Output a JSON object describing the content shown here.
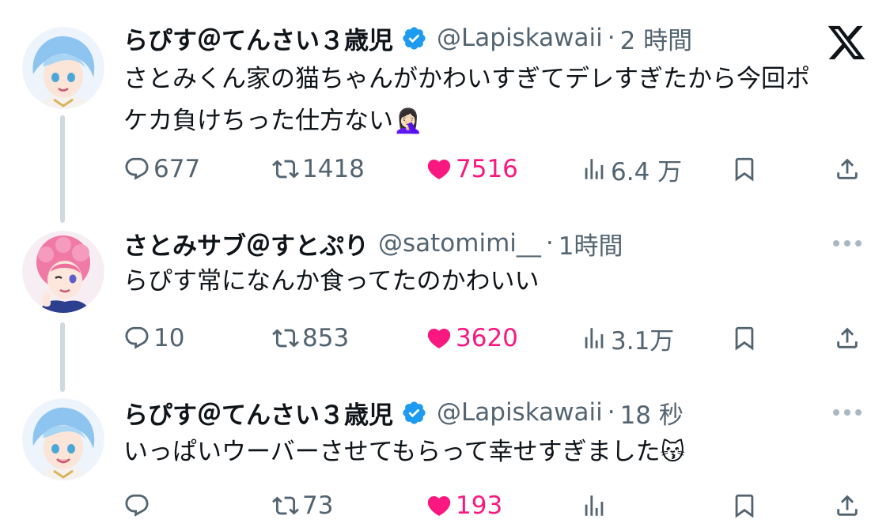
{
  "platform": {
    "logo": "x-logo-icon"
  },
  "colors": {
    "like": "#f91880",
    "verified": "#1d9bf0",
    "muted": "#536471",
    "thread_line": "#cfd9de"
  },
  "tweets": [
    {
      "name": "らぴす＠てんさい３歳児",
      "verified": true,
      "handle": "@Lapiskawaii",
      "separator": "·",
      "time": "2 時間",
      "text_line1": "さとみくん家の猫ちゃんがかわいすぎてデレすぎたから今回ポ",
      "text_line2": "ケカ負けちった仕方ない",
      "emoji": "🤦🏻‍♀️",
      "replies": "677",
      "retweets": "1418",
      "likes": "7516",
      "views": "6.4 万",
      "liked": true
    },
    {
      "name": "さとみサブ＠すとぷり",
      "verified": false,
      "handle": "@satomimi__",
      "separator": "·",
      "time": "1時間",
      "text_line1": "らぴす常になんか食ってたのかわいい",
      "replies": "10",
      "retweets": "853",
      "likes": "3620",
      "views": "3.1万",
      "liked": true
    },
    {
      "name": "らぴす＠てんさい３歳児",
      "verified": true,
      "handle": "@Lapiskawaii",
      "separator": "·",
      "time": "18 秒",
      "text_line1": "いっぱいウーバーさせてもらって幸せすぎました",
      "emoji": "😽",
      "replies": "",
      "retweets": "73",
      "likes": "193",
      "views": "",
      "liked": true
    }
  ]
}
